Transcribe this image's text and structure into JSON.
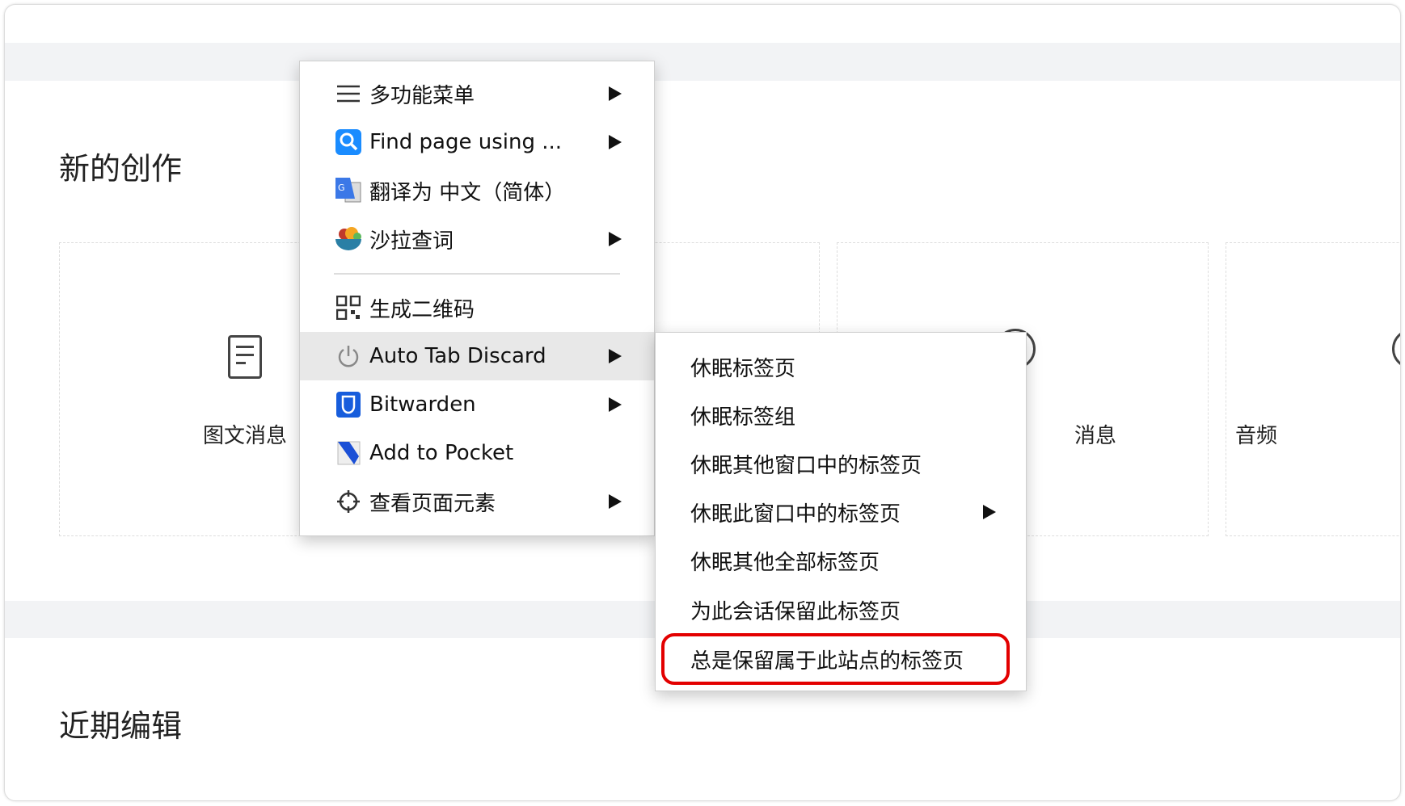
{
  "page": {
    "section_new": "新的创作",
    "section_recent": "近期编辑",
    "cards": [
      {
        "label": "图文消息",
        "icon": "document-icon"
      },
      {
        "label": "",
        "icon": ""
      },
      {
        "label": "消息",
        "icon": "circle-icon"
      },
      {
        "label": "音频",
        "icon": "circle-icon"
      }
    ]
  },
  "context_menu": {
    "items": [
      {
        "label": "多功能菜单",
        "icon": "hamburger-icon",
        "submenu": true
      },
      {
        "label": "Find page using ...",
        "icon": "search-icon",
        "submenu": true
      },
      {
        "label": "翻译为 中文（简体）",
        "icon": "google-translate-icon",
        "submenu": false
      },
      {
        "label": "沙拉查词",
        "icon": "salad-bowl-icon",
        "submenu": true
      },
      {
        "label": "生成二维码",
        "icon": "qr-code-icon",
        "submenu": false
      },
      {
        "label": "Auto Tab Discard",
        "icon": "power-icon",
        "submenu": true,
        "highlighted": true
      },
      {
        "label": "Bitwarden",
        "icon": "bitwarden-shield-icon",
        "submenu": true
      },
      {
        "label": "Add to Pocket",
        "icon": "pocket-icon",
        "submenu": false
      },
      {
        "label": "查看页面元素",
        "icon": "crosshair-icon",
        "submenu": true
      }
    ]
  },
  "submenu": {
    "items": [
      {
        "label": "休眠标签页"
      },
      {
        "label": "休眠标签组"
      },
      {
        "label": "休眠其他窗口中的标签页"
      },
      {
        "label": "休眠此窗口中的标签页",
        "submenu": true
      },
      {
        "label": "休眠其他全部标签页"
      },
      {
        "label": "为此会话保留此标签页"
      },
      {
        "label": "总是保留属于此站点的标签页",
        "highlighted_box": true
      }
    ],
    "highlight_color": "#e30000"
  }
}
